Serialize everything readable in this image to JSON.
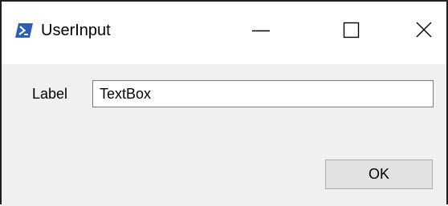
{
  "window": {
    "title": "UserInput",
    "icon": "powershell-icon",
    "controls": [
      "minimize-icon",
      "maximize-icon",
      "close-icon"
    ]
  },
  "form": {
    "label": "Label",
    "textbox_value": "TextBox",
    "ok_label": "OK"
  },
  "colors": {
    "icon_background": "#2a5fb4",
    "titlebar": "#ffffff",
    "client": "#f0f0f0",
    "button_face": "#e1e1e1"
  }
}
